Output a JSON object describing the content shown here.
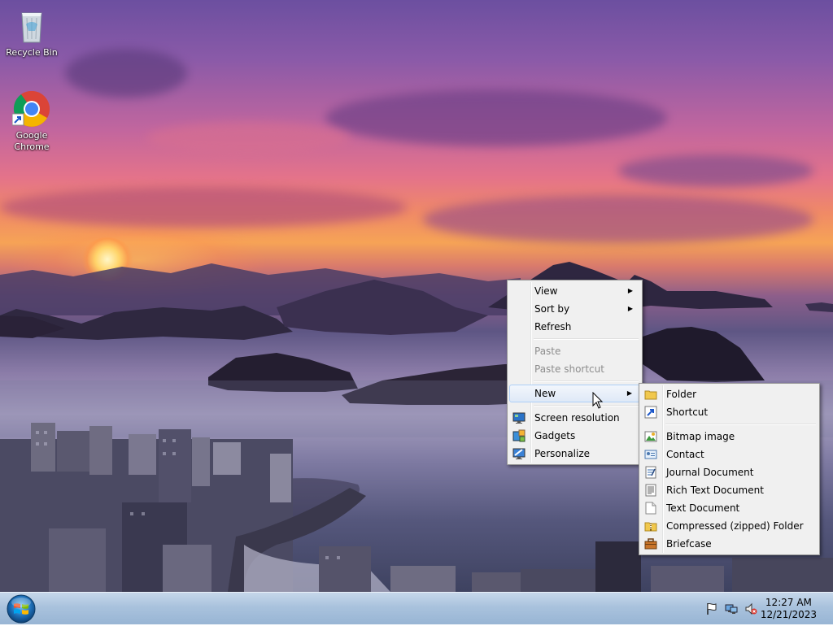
{
  "desktop": {
    "icons": [
      {
        "label": "Recycle Bin",
        "icon": "recycle-bin-icon"
      },
      {
        "label": "Google Chrome",
        "icon": "chrome-icon"
      }
    ]
  },
  "context_menu": {
    "items": {
      "view": "View",
      "sort_by": "Sort by",
      "refresh": "Refresh",
      "paste": "Paste",
      "paste_shortcut": "Paste shortcut",
      "new": "New",
      "screen_resolution": "Screen resolution",
      "gadgets": "Gadgets",
      "personalize": "Personalize"
    }
  },
  "new_submenu": {
    "items": {
      "folder": "Folder",
      "shortcut": "Shortcut",
      "bitmap_image": "Bitmap image",
      "contact": "Contact",
      "journal_document": "Journal Document",
      "rich_text_document": "Rich Text Document",
      "text_document": "Text Document",
      "compressed_folder": "Compressed (zipped) Folder",
      "briefcase": "Briefcase"
    }
  },
  "taskbar": {
    "clock": {
      "time": "12:27 AM",
      "date": "12/21/2023"
    },
    "tray_icons": [
      "action-center-flag-icon",
      "network-icon",
      "volume-muted-icon"
    ]
  },
  "colors": {
    "taskbar": "#a9c2dd",
    "menu_bg": "#f0f0f0",
    "menu_hover": "#dfe9f7"
  }
}
